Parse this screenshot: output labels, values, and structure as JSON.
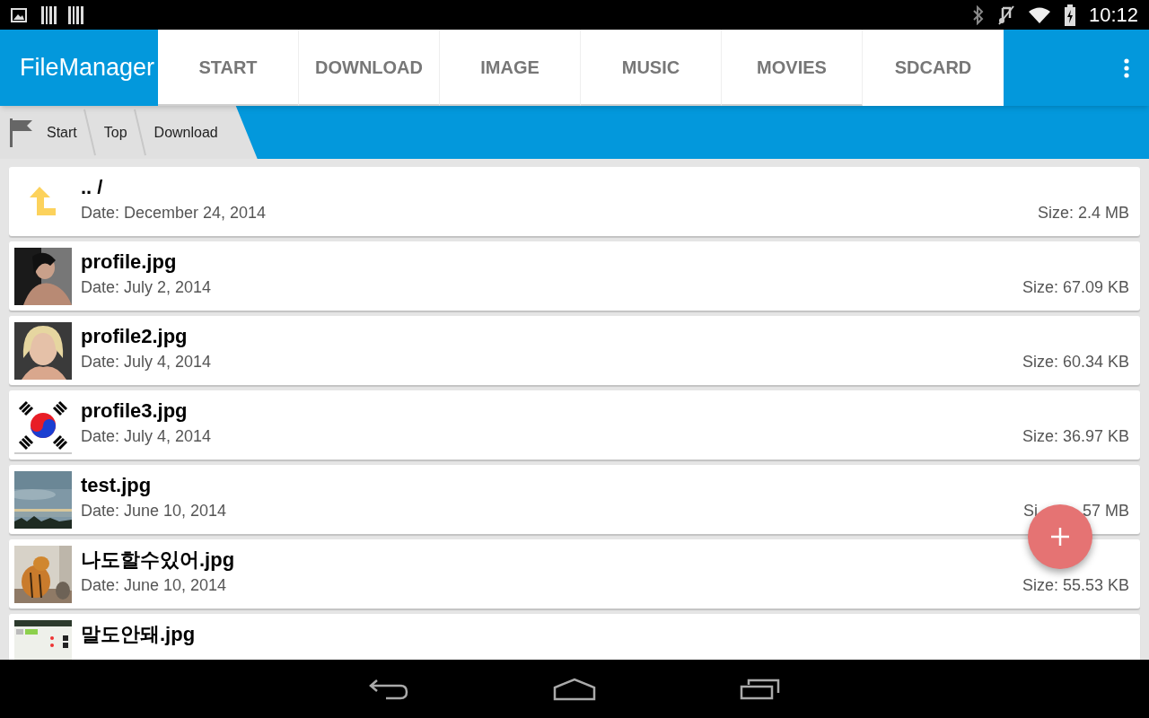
{
  "status_bar": {
    "time": "10:12"
  },
  "app_bar": {
    "title": "FileManager"
  },
  "tabs": [
    {
      "label": "START",
      "selected": false
    },
    {
      "label": "DOWNLOAD",
      "selected": false
    },
    {
      "label": "IMAGE",
      "selected": false
    },
    {
      "label": "MUSIC",
      "selected": false
    },
    {
      "label": "MOVIES",
      "selected": false
    },
    {
      "label": "SDCARD",
      "selected": true
    }
  ],
  "breadcrumb": [
    "Start",
    "Top",
    "Download"
  ],
  "files": [
    {
      "kind": "parent",
      "name": ".. /",
      "date": "Date: December 24, 2014",
      "size": "Size: 2.4 MB"
    },
    {
      "kind": "picture",
      "name": "profile.jpg",
      "date": "Date: July 2, 2014",
      "size": "Size: 67.09 KB"
    },
    {
      "kind": "picture",
      "name": "profile2.jpg",
      "date": "Date: July 4, 2014",
      "size": "Size: 60.34 KB"
    },
    {
      "kind": "picture",
      "name": "profile3.jpg",
      "date": "Date: July 4, 2014",
      "size": "Size: 36.97 KB"
    },
    {
      "kind": "picture",
      "name": "test.jpg",
      "date": "Date: June 10, 2014",
      "size_parts": [
        "Si",
        "57 MB"
      ]
    },
    {
      "kind": "picture",
      "name": "나도할수있어.jpg",
      "date": "Date: June 10, 2014",
      "size": "Size: 55.53 KB"
    },
    {
      "kind": "picture",
      "name": "말도안돼.jpg"
    }
  ]
}
